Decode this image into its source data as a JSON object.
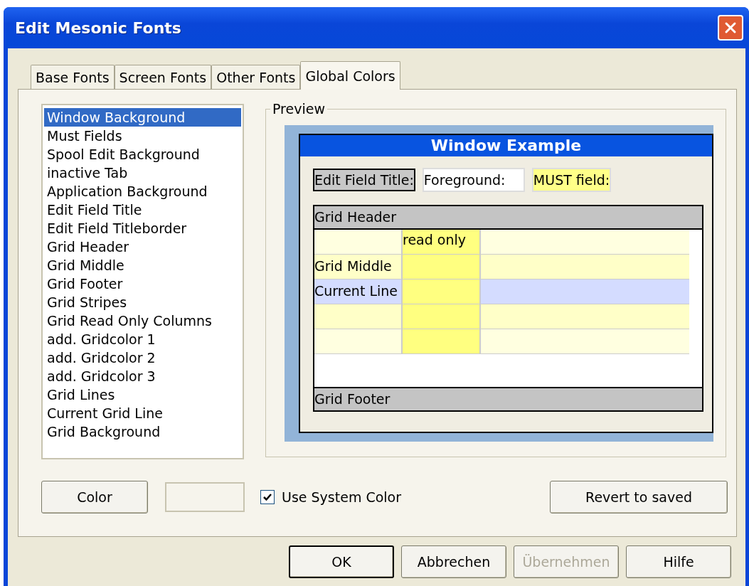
{
  "window": {
    "title": "Edit Mesonic Fonts"
  },
  "tabs": [
    {
      "label": "Base Fonts",
      "selected": false
    },
    {
      "label": "Screen Fonts",
      "selected": false
    },
    {
      "label": "Other Fonts",
      "selected": false
    },
    {
      "label": "Global Colors",
      "selected": true
    }
  ],
  "color_list": [
    {
      "label": "Window Background",
      "selected": true
    },
    {
      "label": "Must Fields",
      "selected": false
    },
    {
      "label": "Spool Edit Background",
      "selected": false
    },
    {
      "label": "inactive Tab",
      "selected": false
    },
    {
      "label": "Application Background",
      "selected": false
    },
    {
      "label": "Edit Field Title",
      "selected": false
    },
    {
      "label": "Edit Field Titleborder",
      "selected": false
    },
    {
      "label": "Grid Header",
      "selected": false
    },
    {
      "label": "Grid Middle",
      "selected": false
    },
    {
      "label": "Grid Footer",
      "selected": false
    },
    {
      "label": "Grid Stripes",
      "selected": false
    },
    {
      "label": "Grid Read Only Columns",
      "selected": false
    },
    {
      "label": "add. Gridcolor 1",
      "selected": false
    },
    {
      "label": "add. Gridcolor 2",
      "selected": false
    },
    {
      "label": "add. Gridcolor 3",
      "selected": false
    },
    {
      "label": "Grid Lines",
      "selected": false
    },
    {
      "label": "Current Grid Line",
      "selected": false
    },
    {
      "label": "Grid Background",
      "selected": false
    }
  ],
  "preview": {
    "label": "Preview",
    "window_title": "Window Example",
    "edit_field_title": "Edit Field Title:",
    "foreground_field": "Foreground:",
    "must_field": "MUST field:",
    "grid": {
      "header": "Grid Header",
      "footer": "Grid Footer",
      "rows": [
        {
          "kind": "plain",
          "read_only": "read only"
        },
        {
          "kind": "stripe",
          "label": "Grid Middle"
        },
        {
          "kind": "current",
          "label": "Current Line"
        },
        {
          "kind": "stripe"
        },
        {
          "kind": "plain"
        }
      ]
    }
  },
  "color_button": "Color",
  "use_system_color": {
    "label": "Use System Color",
    "checked": true
  },
  "revert_button": "Revert to saved",
  "buttons": [
    {
      "label": "OK",
      "disabled": false,
      "default": true
    },
    {
      "label": "Abbrechen",
      "disabled": false,
      "default": false
    },
    {
      "label": "Übernehmen",
      "disabled": true,
      "default": false
    },
    {
      "label": "Hilfe",
      "disabled": false,
      "default": false
    }
  ]
}
